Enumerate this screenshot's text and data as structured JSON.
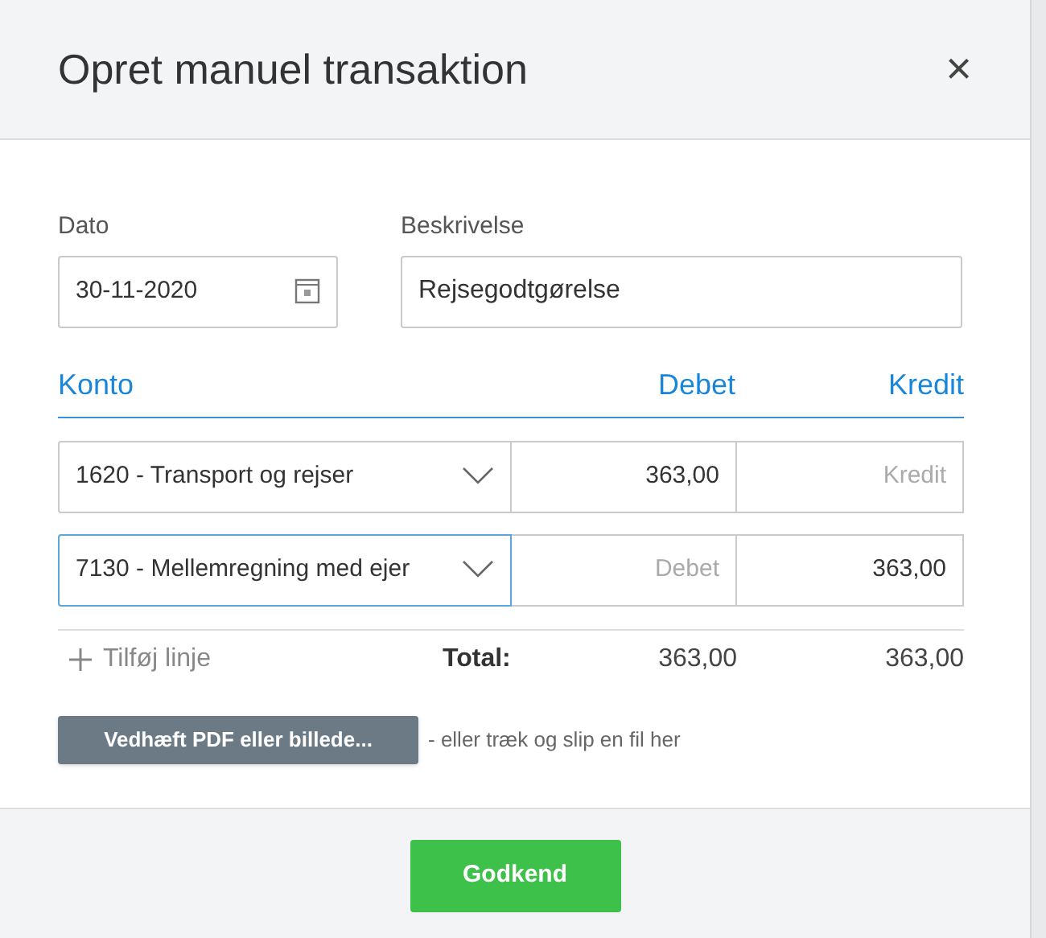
{
  "dialog": {
    "title": "Opret manuel transaktion",
    "close": "×"
  },
  "date": {
    "label": "Dato",
    "value": "30-11-2020"
  },
  "description": {
    "label": "Beskrivelse",
    "value": "Rejsegodtgørelse"
  },
  "columns": [
    "Konto",
    "Debet",
    "Kredit"
  ],
  "lines": [
    {
      "account": "1620 - Transport og rejser",
      "focused": false,
      "debit": {
        "value": "363,00"
      },
      "credit": {
        "placeholder": "Kredit"
      }
    },
    {
      "account": "7130 - Mellemregning med ejer",
      "focused": true,
      "debit": {
        "placeholder": "Debet"
      },
      "credit": {
        "value": "363,00"
      }
    }
  ],
  "add_line": "Tilføj linje",
  "total": {
    "label": "Total:",
    "debit": "363,00",
    "credit": "363,00"
  },
  "attach": {
    "button": "Vedhæft PDF eller billede...",
    "hint": "- eller træk og slip en fil her"
  },
  "approve": "Godkend"
}
